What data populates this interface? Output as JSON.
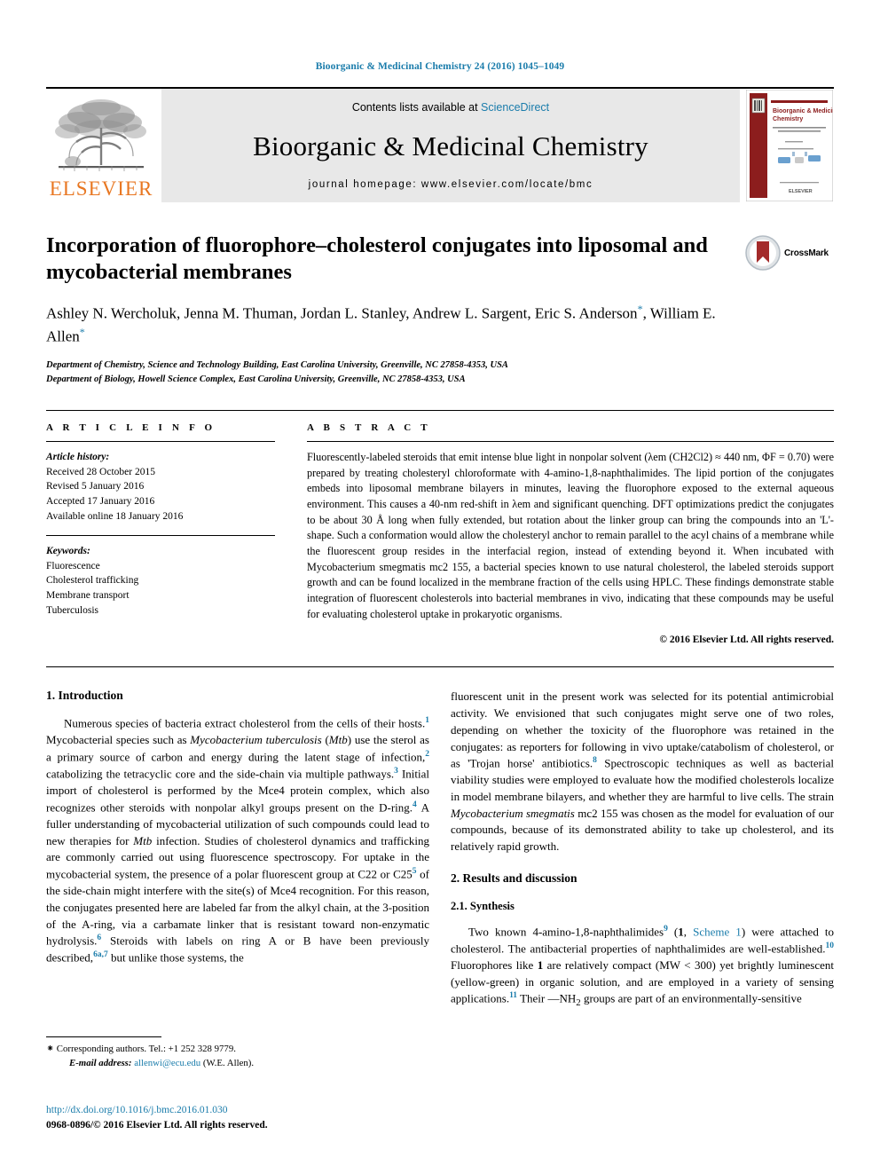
{
  "running_head": "Bioorganic & Medicinal Chemistry 24 (2016) 1045–1049",
  "masthead": {
    "contents_prefix": "Contents lists available at ",
    "sciencedirect": "ScienceDirect",
    "journal_title": "Bioorganic & Medicinal Chemistry",
    "homepage": "journal homepage: www.elsevier.com/locate/bmc",
    "publisher_word": "ELSEVIER",
    "cover_title": "Bioorganic & Medicinal Chemistry"
  },
  "title": "Incorporation of fluorophore–cholesterol conjugates into liposomal and mycobacterial membranes",
  "crossmark_label": "CrossMark",
  "authors": "Ashley N. Wercholuk, Jenna M. Thuman, Jordan L. Stanley, Andrew L. Sargent, Eric S. Anderson",
  "authors_last": "William E. Allen",
  "affiliations": [
    "Department of Chemistry, Science and Technology Building, East Carolina University, Greenville, NC 27858-4353, USA",
    "Department of Biology, Howell Science Complex, East Carolina University, Greenville, NC 27858-4353, USA"
  ],
  "article_info": {
    "kicker": "A R T I C L E   I N F O",
    "history_head": "Article history:",
    "history": [
      "Received 28 October 2015",
      "Revised 5 January 2016",
      "Accepted 17 January 2016",
      "Available online 18 January 2016"
    ],
    "keywords_head": "Keywords:",
    "keywords": [
      "Fluorescence",
      "Cholesterol trafficking",
      "Membrane transport",
      "Tuberculosis"
    ]
  },
  "abstract": {
    "kicker": "A B S T R A C T",
    "text": "Fluorescently-labeled steroids that emit intense blue light in nonpolar solvent (λem (CH2Cl2) ≈ 440 nm, ΦF = 0.70) were prepared by treating cholesteryl chloroformate with 4-amino-1,8-naphthalimides. The lipid portion of the conjugates embeds into liposomal membrane bilayers in minutes, leaving the fluorophore exposed to the external aqueous environment. This causes a 40-nm red-shift in λem and significant quenching. DFT optimizations predict the conjugates to be about 30 Å long when fully extended, but rotation about the linker group can bring the compounds into an 'L'-shape. Such a conformation would allow the cholesteryl anchor to remain parallel to the acyl chains of a membrane while the fluorescent group resides in the interfacial region, instead of extending beyond it. When incubated with Mycobacterium smegmatis mc2 155, a bacterial species known to use natural cholesterol, the labeled steroids support growth and can be found localized in the membrane fraction of the cells using HPLC. These findings demonstrate stable integration of fluorescent cholesterols into bacterial membranes in vivo, indicating that these compounds may be useful for evaluating cholesterol uptake in prokaryotic organisms.",
    "copyright": "© 2016 Elsevier Ltd. All rights reserved."
  },
  "sections": {
    "introduction_heading": "1. Introduction",
    "intro_para_1": "Numerous species of bacteria extract cholesterol from the cells of their hosts.1 Mycobacterial species such as Mycobacterium tuberculosis (Mtb) use the sterol as a primary source of carbon and energy during the latent stage of infection,2 catabolizing the tetracyclic core and the side-chain via multiple pathways.3 Initial import of cholesterol is performed by the Mce4 protein complex, which also recognizes other steroids with nonpolar alkyl groups present on the D-ring.4 A fuller understanding of mycobacterial utilization of such compounds could lead to new therapies for Mtb infection. Studies of cholesterol dynamics and trafficking are commonly carried out using fluorescence spectroscopy. For uptake in the mycobacterial system, the presence of a polar fluorescent group at C22 or C255 of the side-chain might interfere with the site(s) of Mce4 recognition. For this reason, the conjugates presented here are labeled far from the alkyl chain, at the 3-position of the A-ring, via a carbamate linker that is resistant toward non-enzymatic hydrolysis.6 Steroids with labels on ring A or B have been previously described,6a,7 but unlike those systems, the fluorescent unit in the present work was selected for its potential antimicrobial activity. We envisioned that such conjugates might serve one of two roles, depending on whether the toxicity of the fluorophore was retained in the conjugates: as reporters for following in vivo uptake/catabolism of cholesterol, or as 'Trojan horse' antibiotics.8 Spectroscopic techniques as well as bacterial viability studies were employed to evaluate how the modified cholesterols localize in model membrane bilayers, and whether they are harmful to live cells. The strain Mycobacterium smegmatis mc2 155 was chosen as the model for evaluation of our compounds, because of its demonstrated ability to take up cholesterol, and its relatively rapid growth.",
    "results_heading": "2. Results and discussion",
    "synthesis_heading": "2.1. Synthesis",
    "synthesis_para": "Two known 4-amino-1,8-naphthalimides9 (1, Scheme 1) were attached to cholesterol. The antibacterial properties of naphthalimides are well-established.10 Fluorophores like 1 are relatively compact (MW < 300) yet brightly luminescent (yellow-green) in organic solution, and are employed in a variety of sensing applications.11 Their —NH2 groups are part of an environmentally-sensitive",
    "scheme_link": "Scheme 1"
  },
  "footnote": {
    "corresponding": "Corresponding authors. Tel.: +1 252 328 9779.",
    "email_label": "E-mail address:",
    "email": "allenwi@ecu.edu",
    "email_owner": "(W.E. Allen)."
  },
  "doi": "http://dx.doi.org/10.1016/j.bmc.2016.01.030",
  "issn_line": "0968-0896/© 2016 Elsevier Ltd. All rights reserved.",
  "colors": {
    "link": "#1a7cab",
    "elsevier_orange": "#E87722",
    "crossmark_red": "#A32A2A",
    "cover_maroon": "#8C1D1D"
  }
}
